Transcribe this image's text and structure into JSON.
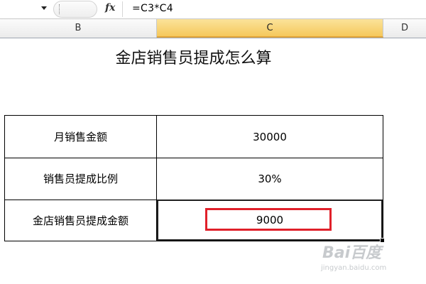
{
  "formula_bar": {
    "fx_label": "fx",
    "formula": "=C3*C4"
  },
  "columns": [
    "B",
    "C",
    "D"
  ],
  "sheet": {
    "title": "金店销售员提成怎么算",
    "rows": [
      {
        "label": "月销售金额",
        "value": "30000"
      },
      {
        "label": "销售员提成比例",
        "value": "30%"
      },
      {
        "label": "金店销售员提成金额",
        "value": "9000"
      }
    ]
  },
  "watermark": {
    "logo": "Bai百度",
    "url": "jingyan.baidu.com"
  },
  "colors": {
    "selected_column_header": "#f5c85c",
    "highlight": "#e0202a"
  }
}
